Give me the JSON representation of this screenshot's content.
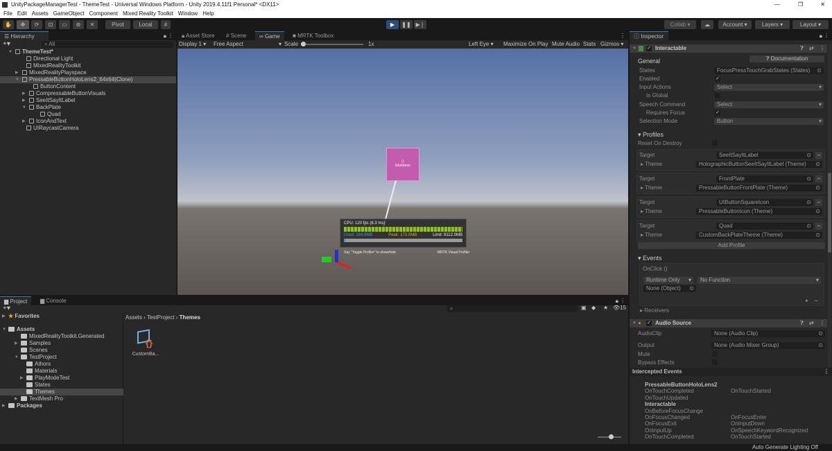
{
  "window": {
    "title": "UnityPackageManagerTest - ThemeTest - Universal Windows Platform - Unity 2019.4.11f1 Personal* <DX11>"
  },
  "menu": [
    "File",
    "Edit",
    "Assets",
    "GameObject",
    "Component",
    "Mixed Reality Toolkit",
    "Window",
    "Help"
  ],
  "toolbar": {
    "pivot": "Pivot",
    "local": "Local",
    "collab": "Collab",
    "account": "Account",
    "layers": "Layers",
    "layout": "Layout"
  },
  "hierarchy": {
    "tab": "Hierarchy",
    "search_placeholder": "All",
    "items": [
      "ThemeTest*",
      "Directional Light",
      "MixedRealityToolkit",
      "MixedRealityPlayspace",
      "PressableButtonHoloLens2_64x64(Clone)",
      "ButtonContent",
      "CompressableButtonVisuals",
      "SeeItSayItLabel",
      "BackPlate",
      "Quad",
      "IconAndText",
      "UIRaycastCamera"
    ]
  },
  "center_tabs": [
    "Asset Store",
    "Scene",
    "Game",
    "MRTK Toolbox"
  ],
  "game": {
    "display": "Display 1",
    "aspect": "Free Aspect",
    "scale_label": "Scale",
    "scale_value": "1x",
    "eye": "Left Eye",
    "maximize": "Maximize On Play",
    "mute": "Mute Audio",
    "stats": "Stats",
    "gizmos": "Gizmos",
    "profiler": {
      "cpu": "CPU: 120 fps (8.3 ms)",
      "used": "Used: 164.8MB",
      "peak": "Peak: 173.0MB",
      "limit": "Limit: 8112.0MB",
      "toggle_hint": "Say \"Toggle Profiler\" to show/hide",
      "brand": "MRTK Visual Profiler",
      "memory_fraction": 0.02
    },
    "button_label": "64x64mm"
  },
  "project": {
    "tabs": [
      "Project",
      "Console"
    ],
    "favorites": "Favorites",
    "tree": [
      "Assets",
      "MixedRealityToolkit.Generated",
      "Samples",
      "Scenes",
      "TestProject",
      "Athors",
      "Materials",
      "PlayModeTest",
      "States",
      "Themes",
      "TextMesh Pro",
      "Packages"
    ],
    "breadcrumb": [
      "Assets",
      "TestProject",
      "Themes"
    ],
    "hidden_count": "15",
    "asset": "CustomBa..."
  },
  "inspector": {
    "tab": "Inspector",
    "component": "Interactable",
    "documentation": "Documentation",
    "general": "General",
    "fields": [
      {
        "label": "States",
        "value": "FocusPressTouchGrabStates (States)"
      },
      {
        "label": "Enabled",
        "value": "✓"
      },
      {
        "label": "Input Actions",
        "value": "Select"
      },
      {
        "label": "Is Global",
        "value": ""
      },
      {
        "label": "Speech Command",
        "value": "Select"
      },
      {
        "label": "Requires Focus",
        "value": "✓"
      },
      {
        "label": "Selection Mode",
        "value": "Button"
      }
    ],
    "profiles": "Profiles",
    "reset_on_destroy": "Reset On Destroy",
    "target_label": "Target",
    "theme_label": "Theme",
    "profile_list": [
      {
        "target": "SeeItSayItLabel",
        "theme": "HolographicButtonSeeItSayItLabel (Theme)"
      },
      {
        "target": "FrontPlate",
        "theme": "PressableButtonFrontPlate (Theme)"
      },
      {
        "target": "UIButtonSquareIcon",
        "theme": "PressableButtonIcon (Theme)"
      },
      {
        "target": "Quad",
        "theme": "CustomBackPlateTheme (Theme)"
      }
    ],
    "add_profile": "Add Profile",
    "events": "Events",
    "onclick": "OnClick ()",
    "runtime": "Runtime Only",
    "nofunc": "No Function",
    "none_object": "None (Object)",
    "receivers": "Receivers",
    "audio": {
      "title": "Audio Source",
      "clip_label": "AudioClip",
      "clip": "None (Audio Clip)",
      "output_label": "Output",
      "output": "None (Audio Mixer Group)",
      "mute": "Mute",
      "bypass": "Bypass Effects"
    },
    "intercepted": {
      "title": "Intercepted Events",
      "rows": [
        [
          "PressableButtonHoloLens2",
          ""
        ],
        [
          "OnTouchCompleted",
          "OnTouchStarted"
        ],
        [
          "OnTouchUpdated",
          ""
        ],
        [
          "Interactable",
          ""
        ],
        [
          "OnBeforeFocusChange",
          ""
        ],
        [
          "OnFocusChanged",
          "OnFocusEnter"
        ],
        [
          "OnFocusExit",
          "OnInputDown"
        ],
        [
          "OnInputUp",
          "OnSpeechKeywordRecognized"
        ],
        [
          "OnTouchCompleted",
          "OnTouchStarted"
        ]
      ]
    }
  },
  "status": "Auto Generate Lighting Off",
  "colors": {
    "accent": "#3a79bb",
    "play_active": "#2a4f78",
    "panel": "#282828",
    "profiler_bar": "#8ec21a",
    "used": "#3a9bd6",
    "peak": "#e0a030"
  }
}
